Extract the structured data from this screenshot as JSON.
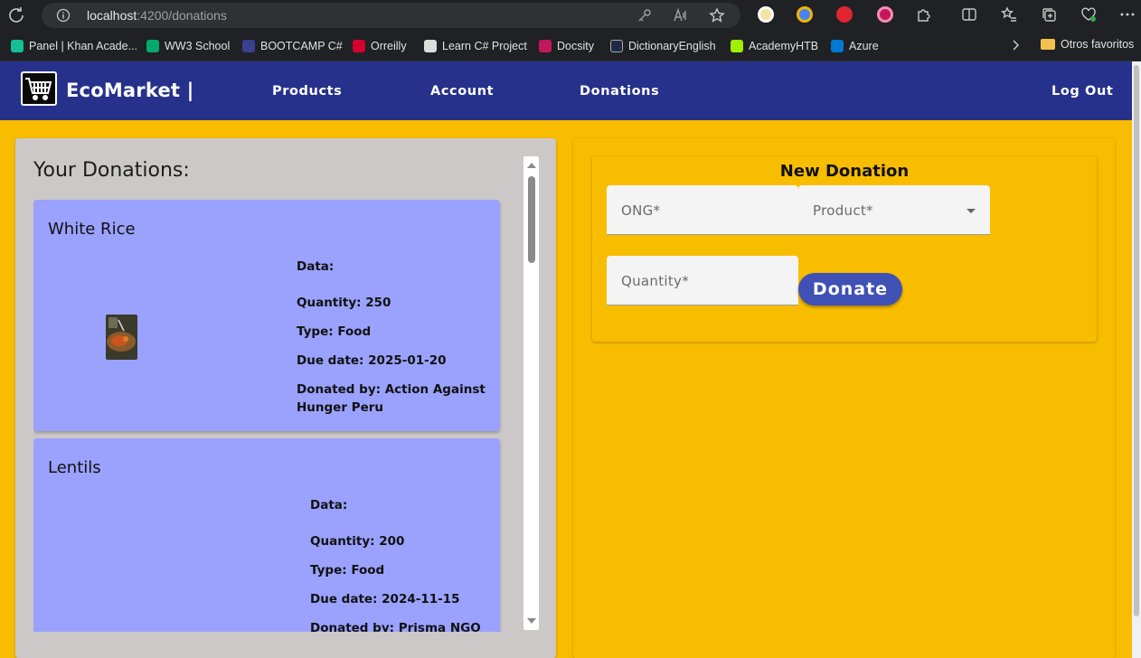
{
  "browser": {
    "url_host": "localhost",
    "url_path": ":4200/donations",
    "bookmarks": [
      {
        "label": "Panel | Khan Acade...",
        "color": "#14bf96"
      },
      {
        "label": "WW3 School",
        "color": "#04aa6d"
      },
      {
        "label": "BOOTCAMP C#",
        "color": "#3a3f8f"
      },
      {
        "label": "Orreilly",
        "color": "#d3002d"
      },
      {
        "label": "Learn C# Project",
        "color": "#dddddd"
      },
      {
        "label": "Docsity",
        "color": "#c2185b"
      },
      {
        "label": "DictionaryEnglish",
        "color": "#1f2a44"
      },
      {
        "label": "AcademyHTB",
        "color": "#9fef00"
      },
      {
        "label": "Azure",
        "color": "#0078d4"
      }
    ],
    "bookmarks_folder": "Otros favoritos"
  },
  "nav": {
    "brand": "EcoMarket |",
    "links": [
      "Products",
      "Account",
      "Donations"
    ],
    "logout": "Log Out"
  },
  "donations": {
    "title": "Your Donations:",
    "items": [
      {
        "name": "White Rice",
        "data_label": "Data:",
        "quantity": "Quantity: 250",
        "type": "Type: Food",
        "due_date": "Due date: 2025-01-20",
        "donated_by_line1": "Donated by: Action Against",
        "donated_by_line2": "Hunger Peru"
      },
      {
        "name": "Lentils",
        "data_label": "Data:",
        "quantity": "Quantity: 200",
        "type": "Type: Food",
        "due_date": "Due date: 2024-11-15",
        "donated_by_line1": "Donated by: Prisma NGO",
        "donated_by_line2": ""
      }
    ]
  },
  "form": {
    "title": "New Donation",
    "ong_placeholder": "ONG*",
    "product_placeholder": "Product*",
    "quantity_placeholder": "Quantity*",
    "donate_label": "Donate"
  },
  "colors": {
    "navbar": "#26318b",
    "page_background": "#f9bd00",
    "card": "#9aa2fd",
    "panel": "#cdc8c8",
    "button": "#3f51b5"
  }
}
